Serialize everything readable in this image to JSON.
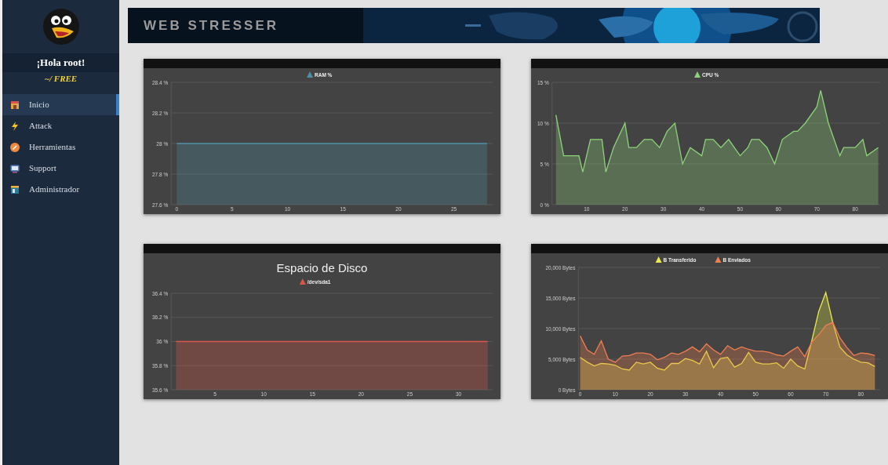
{
  "sidebar": {
    "greeting": "¡Hola root!",
    "plan": "~/ FREE",
    "items": [
      {
        "label": "Inicio",
        "selected": true
      },
      {
        "label": "Attack",
        "selected": false
      },
      {
        "label": "Herramientas",
        "selected": false
      },
      {
        "label": "Support",
        "selected": false
      },
      {
        "label": "Administrador",
        "selected": false
      }
    ]
  },
  "banner": {
    "title": "WEB STRESSER"
  },
  "charts": [
    {
      "chart_data": {
        "type": "area",
        "grid": true,
        "legend": true,
        "x": [
          0,
          28
        ],
        "series": [
          {
            "name": "RAM %",
            "color": "#4f8fa3",
            "values": [
              28,
              28
            ]
          }
        ],
        "xlim": [
          -0.5,
          28.5
        ],
        "ylim": [
          27.6,
          28.4
        ],
        "xticks": [
          0,
          5,
          10,
          15,
          20,
          25
        ],
        "yticks": [
          {
            "value": 27.6,
            "label": "27.6 %"
          },
          {
            "value": 27.8,
            "label": "27.8 %"
          },
          {
            "value": 28,
            "label": "28 %"
          },
          {
            "value": 28.2,
            "label": "28.2 %"
          },
          {
            "value": 28.4,
            "label": "28.4 %"
          }
        ]
      }
    },
    {
      "chart_data": {
        "type": "area",
        "grid": true,
        "legend": true,
        "x": [
          2,
          4,
          6,
          8,
          9,
          11,
          14,
          15,
          17,
          20,
          21,
          23,
          25,
          27,
          29,
          31,
          33,
          35,
          37,
          40,
          41,
          43,
          45,
          47,
          50,
          52,
          53,
          55,
          57,
          59,
          61,
          64,
          65,
          67,
          70,
          71,
          73,
          76,
          77,
          80,
          82,
          83,
          86
        ],
        "series": [
          {
            "name": "CPU %",
            "color": "#8ed47a",
            "values": [
              11,
              6,
              6,
              6,
              4,
              8,
              8,
              4,
              7,
              10,
              7,
              7,
              8,
              8,
              7,
              9,
              10,
              5,
              7,
              6,
              8,
              8,
              7,
              8,
              6,
              7,
              8,
              8,
              7,
              5,
              8,
              9,
              9,
              10,
              12,
              14,
              10,
              6,
              7,
              7,
              8,
              6,
              7
            ]
          }
        ],
        "xlim": [
          1,
          86.5
        ],
        "ylim": [
          0,
          15
        ],
        "xticks": [
          10,
          20,
          30,
          40,
          50,
          60,
          70,
          80
        ],
        "yticks": [
          {
            "value": 0,
            "label": "0 %"
          },
          {
            "value": 5,
            "label": "5 %"
          },
          {
            "value": 10,
            "label": "10 %"
          },
          {
            "value": 15,
            "label": "15 %"
          }
        ]
      }
    },
    {
      "chart_data": {
        "type": "area",
        "grid": true,
        "legend": true,
        "title": "Espacio de Disco",
        "x": [
          1,
          33
        ],
        "series": [
          {
            "name": "/dev/sda1",
            "color": "#d9574a",
            "values": [
              36,
              36
            ]
          }
        ],
        "xlim": [
          0.5,
          33.5
        ],
        "ylim": [
          35.6,
          36.4
        ],
        "xticks": [
          5,
          10,
          15,
          20,
          25,
          30
        ],
        "yticks": [
          {
            "value": 35.6,
            "label": "35.6 %"
          },
          {
            "value": 35.8,
            "label": "35.8 %"
          },
          {
            "value": 36,
            "label": "36 %"
          },
          {
            "value": 36.2,
            "label": "36.2 %"
          },
          {
            "value": 36.4,
            "label": "36.4 %"
          }
        ]
      }
    },
    {
      "chart_data": {
        "type": "area",
        "grid": true,
        "legend": true,
        "x": [
          0,
          2,
          4,
          6,
          8,
          10,
          12,
          14,
          16,
          18,
          20,
          22,
          24,
          26,
          28,
          30,
          32,
          34,
          36,
          38,
          40,
          42,
          44,
          46,
          48,
          50,
          52,
          54,
          56,
          58,
          60,
          62,
          64,
          66,
          68,
          70,
          72,
          74,
          76,
          78,
          80,
          82,
          84
        ],
        "series": [
          {
            "name": "B Transferido",
            "color": "#e9ea4c",
            "values": [
              5300,
              4500,
              3900,
              4300,
              4200,
              4000,
              3400,
              3200,
              4500,
              4200,
              4500,
              3500,
              3200,
              4300,
              4300,
              5100,
              4800,
              4200,
              6300,
              3600,
              5100,
              5300,
              3700,
              4300,
              6100,
              4500,
              4200,
              4200,
              4400,
              3500,
              5000,
              3900,
              3400,
              8000,
              12800,
              15900,
              11000,
              7000,
              5700,
              5000,
              4500,
              4400,
              3800
            ]
          },
          {
            "name": "B Enviados",
            "color": "#ef7f50",
            "values": [
              8800,
              6500,
              5800,
              8000,
              5000,
              4500,
              5500,
              5600,
              6000,
              6000,
              5800,
              4900,
              5300,
              6000,
              5800,
              6300,
              7000,
              6200,
              7500,
              6500,
              5800,
              7200,
              6500,
              7000,
              6600,
              6300,
              6300,
              6100,
              5700,
              5500,
              6300,
              7000,
              5400,
              7800,
              9000,
              10500,
              11000,
              8500,
              6900,
              5600,
              6000,
              5900,
              5600
            ]
          }
        ],
        "xlim": [
          -0.5,
          85.5
        ],
        "ylim": [
          0,
          20000
        ],
        "xticks": [
          0,
          10,
          20,
          30,
          40,
          50,
          60,
          70,
          80
        ],
        "yticks": [
          {
            "value": 0,
            "label": "0 Bytes"
          },
          {
            "value": 5000,
            "label": "5,000 Bytes"
          },
          {
            "value": 10000,
            "label": "10,000 Bytes"
          },
          {
            "value": 15000,
            "label": "15,000 Bytes"
          },
          {
            "value": 20000,
            "label": "20,000 Bytes"
          }
        ]
      }
    }
  ]
}
